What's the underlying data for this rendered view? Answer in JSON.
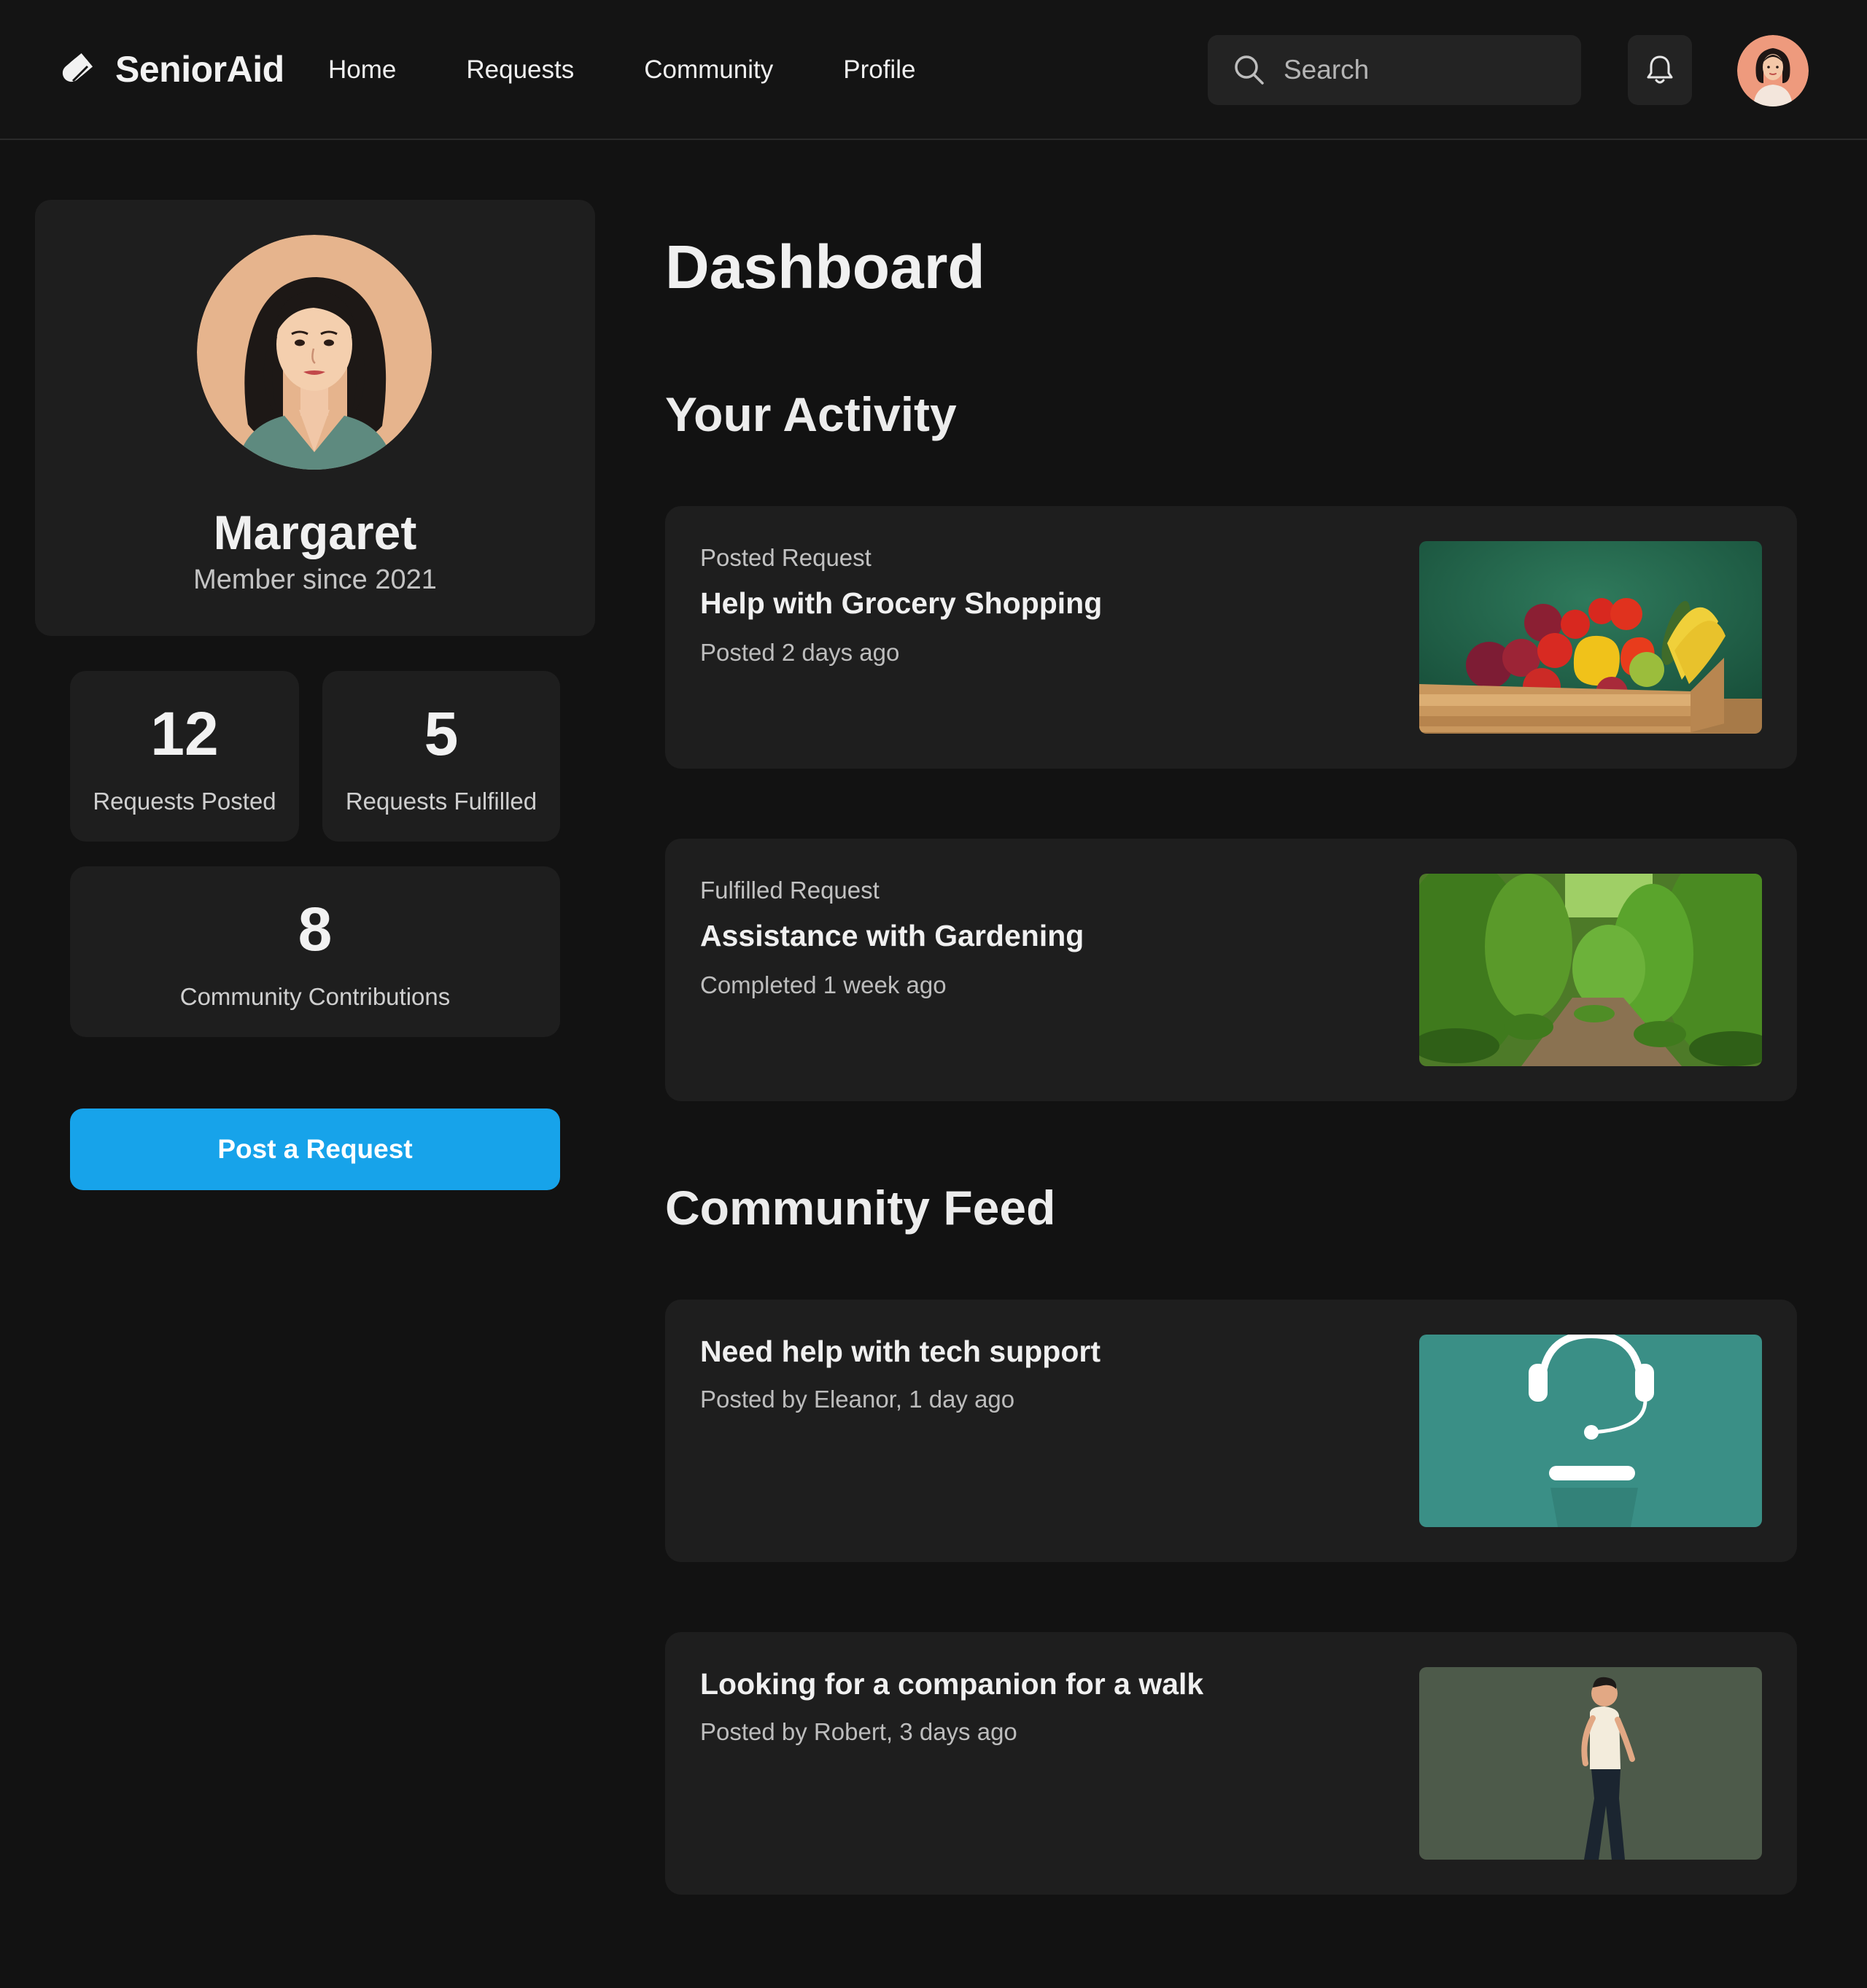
{
  "brand": {
    "name": "SeniorAid"
  },
  "nav": {
    "items": [
      {
        "label": "Home"
      },
      {
        "label": "Requests"
      },
      {
        "label": "Community"
      },
      {
        "label": "Profile"
      }
    ]
  },
  "search": {
    "placeholder": "Search"
  },
  "profile": {
    "name": "Margaret",
    "member_since": "Member since 2021"
  },
  "stats": {
    "requests_posted": {
      "value": "12",
      "label": "Requests Posted"
    },
    "requests_fulfilled": {
      "value": "5",
      "label": "Requests Fulfilled"
    },
    "community_contributions": {
      "value": "8",
      "label": "Community Contributions"
    }
  },
  "actions": {
    "post_request": "Post a Request"
  },
  "page": {
    "title": "Dashboard"
  },
  "activity": {
    "title": "Your Activity",
    "items": [
      {
        "kicker": "Posted Request",
        "title": "Help with Grocery Shopping",
        "meta": "Posted 2 days ago",
        "image": "grocery-crate-image"
      },
      {
        "kicker": "Fulfilled Request",
        "title": "Assistance with Gardening",
        "meta": "Completed 1 week ago",
        "image": "garden-image"
      }
    ]
  },
  "feed": {
    "title": "Community Feed",
    "items": [
      {
        "title": "Need help with tech support",
        "meta": "Posted by Eleanor, 1 day ago",
        "image": "headset-image"
      },
      {
        "title": "Looking for a companion for a walk",
        "meta": "Posted by Robert, 3 days ago",
        "image": "walking-man-image"
      }
    ]
  },
  "colors": {
    "background": "#121212",
    "card": "#1e1e1e",
    "accent": "#17a3ea"
  }
}
